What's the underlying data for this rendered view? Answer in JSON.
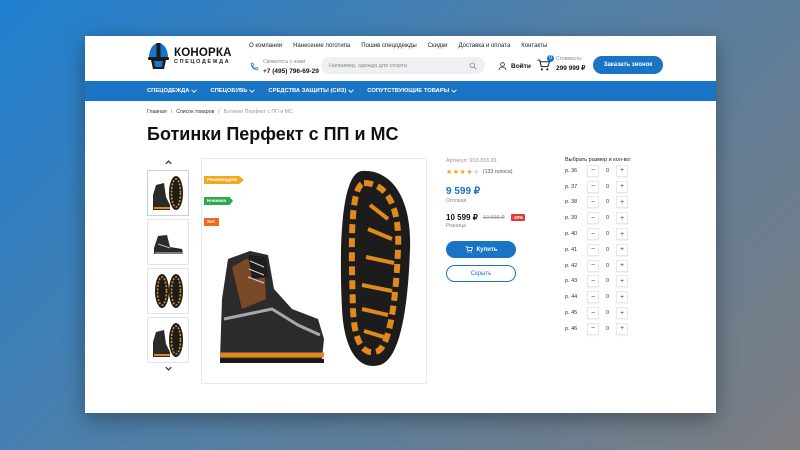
{
  "header": {
    "logo": {
      "name": "КОНОРКА",
      "sub": "СПЕЦОДЕЖДА"
    },
    "top_nav": [
      "О компании",
      "Нанесение логотипа",
      "Пошив спецодежды",
      "Скидки",
      "Доставка и оплата",
      "Контакты"
    ],
    "phone": {
      "note": "Свяжитесь с нами",
      "number": "+7 (495) 796-69-29"
    },
    "search": {
      "placeholder": "Например, одежда для спорта"
    },
    "login_label": "Войти",
    "cart": {
      "count": "0",
      "label": "Стоимость:",
      "sum": "299 999 ₽"
    },
    "callback_label": "Заказать звонок"
  },
  "menu": [
    "СПЕЦОДЕЖДА",
    "СПЕЦОБУВЬ",
    "СРЕДСТВА ЗАЩИТЫ (СИЗ)",
    "СОПУТСТВУЮЩИЕ ТОВАРЫ"
  ],
  "breadcrumbs": [
    "Главная",
    "Список товаров",
    "Ботинки Перфект с ПП и МС"
  ],
  "product": {
    "title": "Ботинки Перфект с ПП и МС",
    "badges": [
      "Рекомендуем",
      "Новинка",
      "Хит"
    ],
    "sku": "Артикул: 903.816.81",
    "rating": 3.5,
    "votes": "(133 голоса)",
    "price_wholesale": "9 599 ₽",
    "price_wholesale_note": "Оптовая",
    "price_retail": "10 599 ₽",
    "price_old": "10 599 ₽",
    "discount": "-30%",
    "price_retail_note": "Розница",
    "buy_label": "Купить",
    "hide_label": "Скрыть"
  },
  "sizes": {
    "title": "Выбрать размер и кол-во:",
    "rows": [
      {
        "label": "р. 36",
        "qty": "0"
      },
      {
        "label": "р. 37",
        "qty": "0"
      },
      {
        "label": "р. 38",
        "qty": "0"
      },
      {
        "label": "р. 39",
        "qty": "0"
      },
      {
        "label": "р. 40",
        "qty": "0"
      },
      {
        "label": "р. 41",
        "qty": "0"
      },
      {
        "label": "р. 42",
        "qty": "0"
      },
      {
        "label": "р. 43",
        "qty": "0"
      },
      {
        "label": "р. 44",
        "qty": "0"
      },
      {
        "label": "р. 45",
        "qty": "0"
      },
      {
        "label": "р. 46",
        "qty": "0"
      }
    ],
    "minus": "−",
    "plus": "+"
  },
  "icons": {
    "logo": "helmet-logo-icon",
    "phone": "phone-icon",
    "search": "search-icon",
    "user": "user-icon",
    "cart": "cart-icon",
    "chevron": "chevron-down-icon",
    "thumb_up": "chevron-up-icon",
    "thumb_down": "chevron-down-icon"
  },
  "colors": {
    "brand": "#1974c6",
    "badge_recommend": "#f0a91b",
    "badge_new": "#2daa4b",
    "badge_hit": "#f06a1d",
    "discount": "#e53935"
  }
}
